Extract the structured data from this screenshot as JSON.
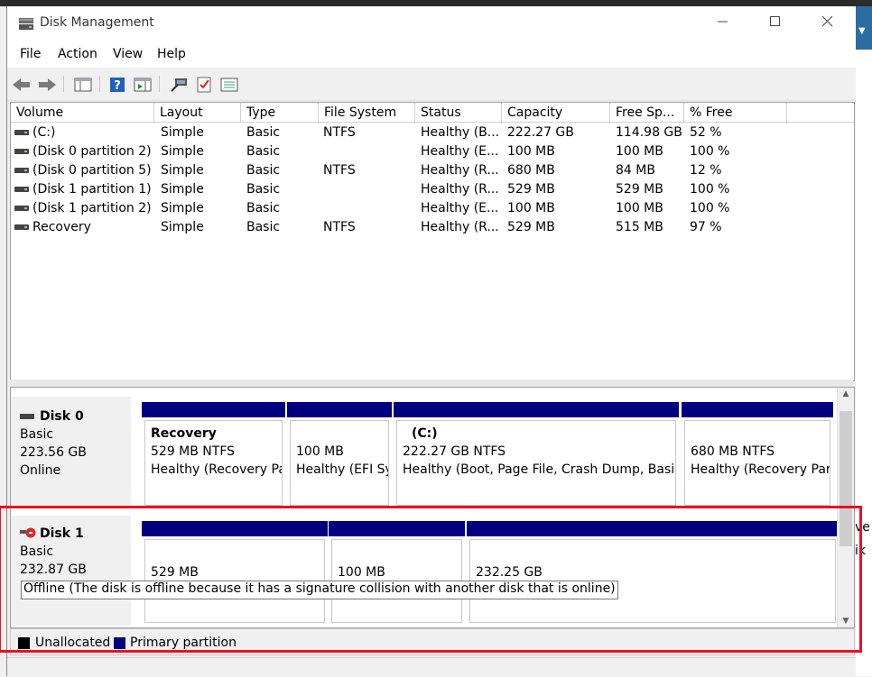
{
  "window": {
    "title": "Disk Management"
  },
  "menu": [
    "File",
    "Action",
    "View",
    "Help"
  ],
  "toolbar_icons": [
    "back-arrow-icon",
    "forward-arrow-icon",
    "console-tree-icon",
    "help-icon",
    "properties-icon",
    "connect-icon",
    "check-icon",
    "list-icon"
  ],
  "columns": [
    "Volume",
    "Layout",
    "Type",
    "File System",
    "Status",
    "Capacity",
    "Free Sp...",
    "% Free"
  ],
  "volumes": [
    {
      "name": "(C:)",
      "layout": "Simple",
      "type": "Basic",
      "fs": "NTFS",
      "status": "Healthy (B...",
      "capacity": "222.27 GB",
      "free": "114.98 GB",
      "pct": "52 %"
    },
    {
      "name": "(Disk 0 partition 2)",
      "layout": "Simple",
      "type": "Basic",
      "fs": "",
      "status": "Healthy (E...",
      "capacity": "100 MB",
      "free": "100 MB",
      "pct": "100 %"
    },
    {
      "name": "(Disk 0 partition 5)",
      "layout": "Simple",
      "type": "Basic",
      "fs": "NTFS",
      "status": "Healthy (R...",
      "capacity": "680 MB",
      "free": "84 MB",
      "pct": "12 %"
    },
    {
      "name": "(Disk 1 partition 1)",
      "layout": "Simple",
      "type": "Basic",
      "fs": "",
      "status": "Healthy (R...",
      "capacity": "529 MB",
      "free": "529 MB",
      "pct": "100 %"
    },
    {
      "name": "(Disk 1 partition 2)",
      "layout": "Simple",
      "type": "Basic",
      "fs": "",
      "status": "Healthy (E...",
      "capacity": "100 MB",
      "free": "100 MB",
      "pct": "100 %"
    },
    {
      "name": "Recovery",
      "layout": "Simple",
      "type": "Basic",
      "fs": "NTFS",
      "status": "Healthy (R...",
      "capacity": "529 MB",
      "free": "515 MB",
      "pct": "97 %"
    }
  ],
  "disk0": {
    "name": "Disk 0",
    "type": "Basic",
    "size": "223.56 GB",
    "state": "Online",
    "partitions": [
      {
        "title": "Recovery",
        "size": "529 MB NTFS",
        "status": "Healthy (Recovery Pa"
      },
      {
        "title": "",
        "size": "100 MB",
        "status": "Healthy (EFI Sy"
      },
      {
        "title": "(C:)",
        "size": "222.27 GB NTFS",
        "status": "Healthy (Boot, Page File, Crash Dump, Basic D"
      },
      {
        "title": "",
        "size": "680 MB NTFS",
        "status": "Healthy (Recovery Part"
      }
    ]
  },
  "disk1": {
    "name": "Disk 1",
    "type": "Basic",
    "size": "232.87 GB",
    "partitions": [
      {
        "size": "529 MB"
      },
      {
        "size": "100 MB"
      },
      {
        "size": "232.25 GB"
      }
    ],
    "tooltip": "Offline (The disk is offline because it has a signature collision with another disk that is online)"
  },
  "legend": {
    "unallocated": "Unallocated",
    "primary": "Primary partition",
    "colors": {
      "unallocated": "#000000",
      "primary": "#000080"
    }
  },
  "background_fragments": [
    "ve",
    "ik"
  ]
}
